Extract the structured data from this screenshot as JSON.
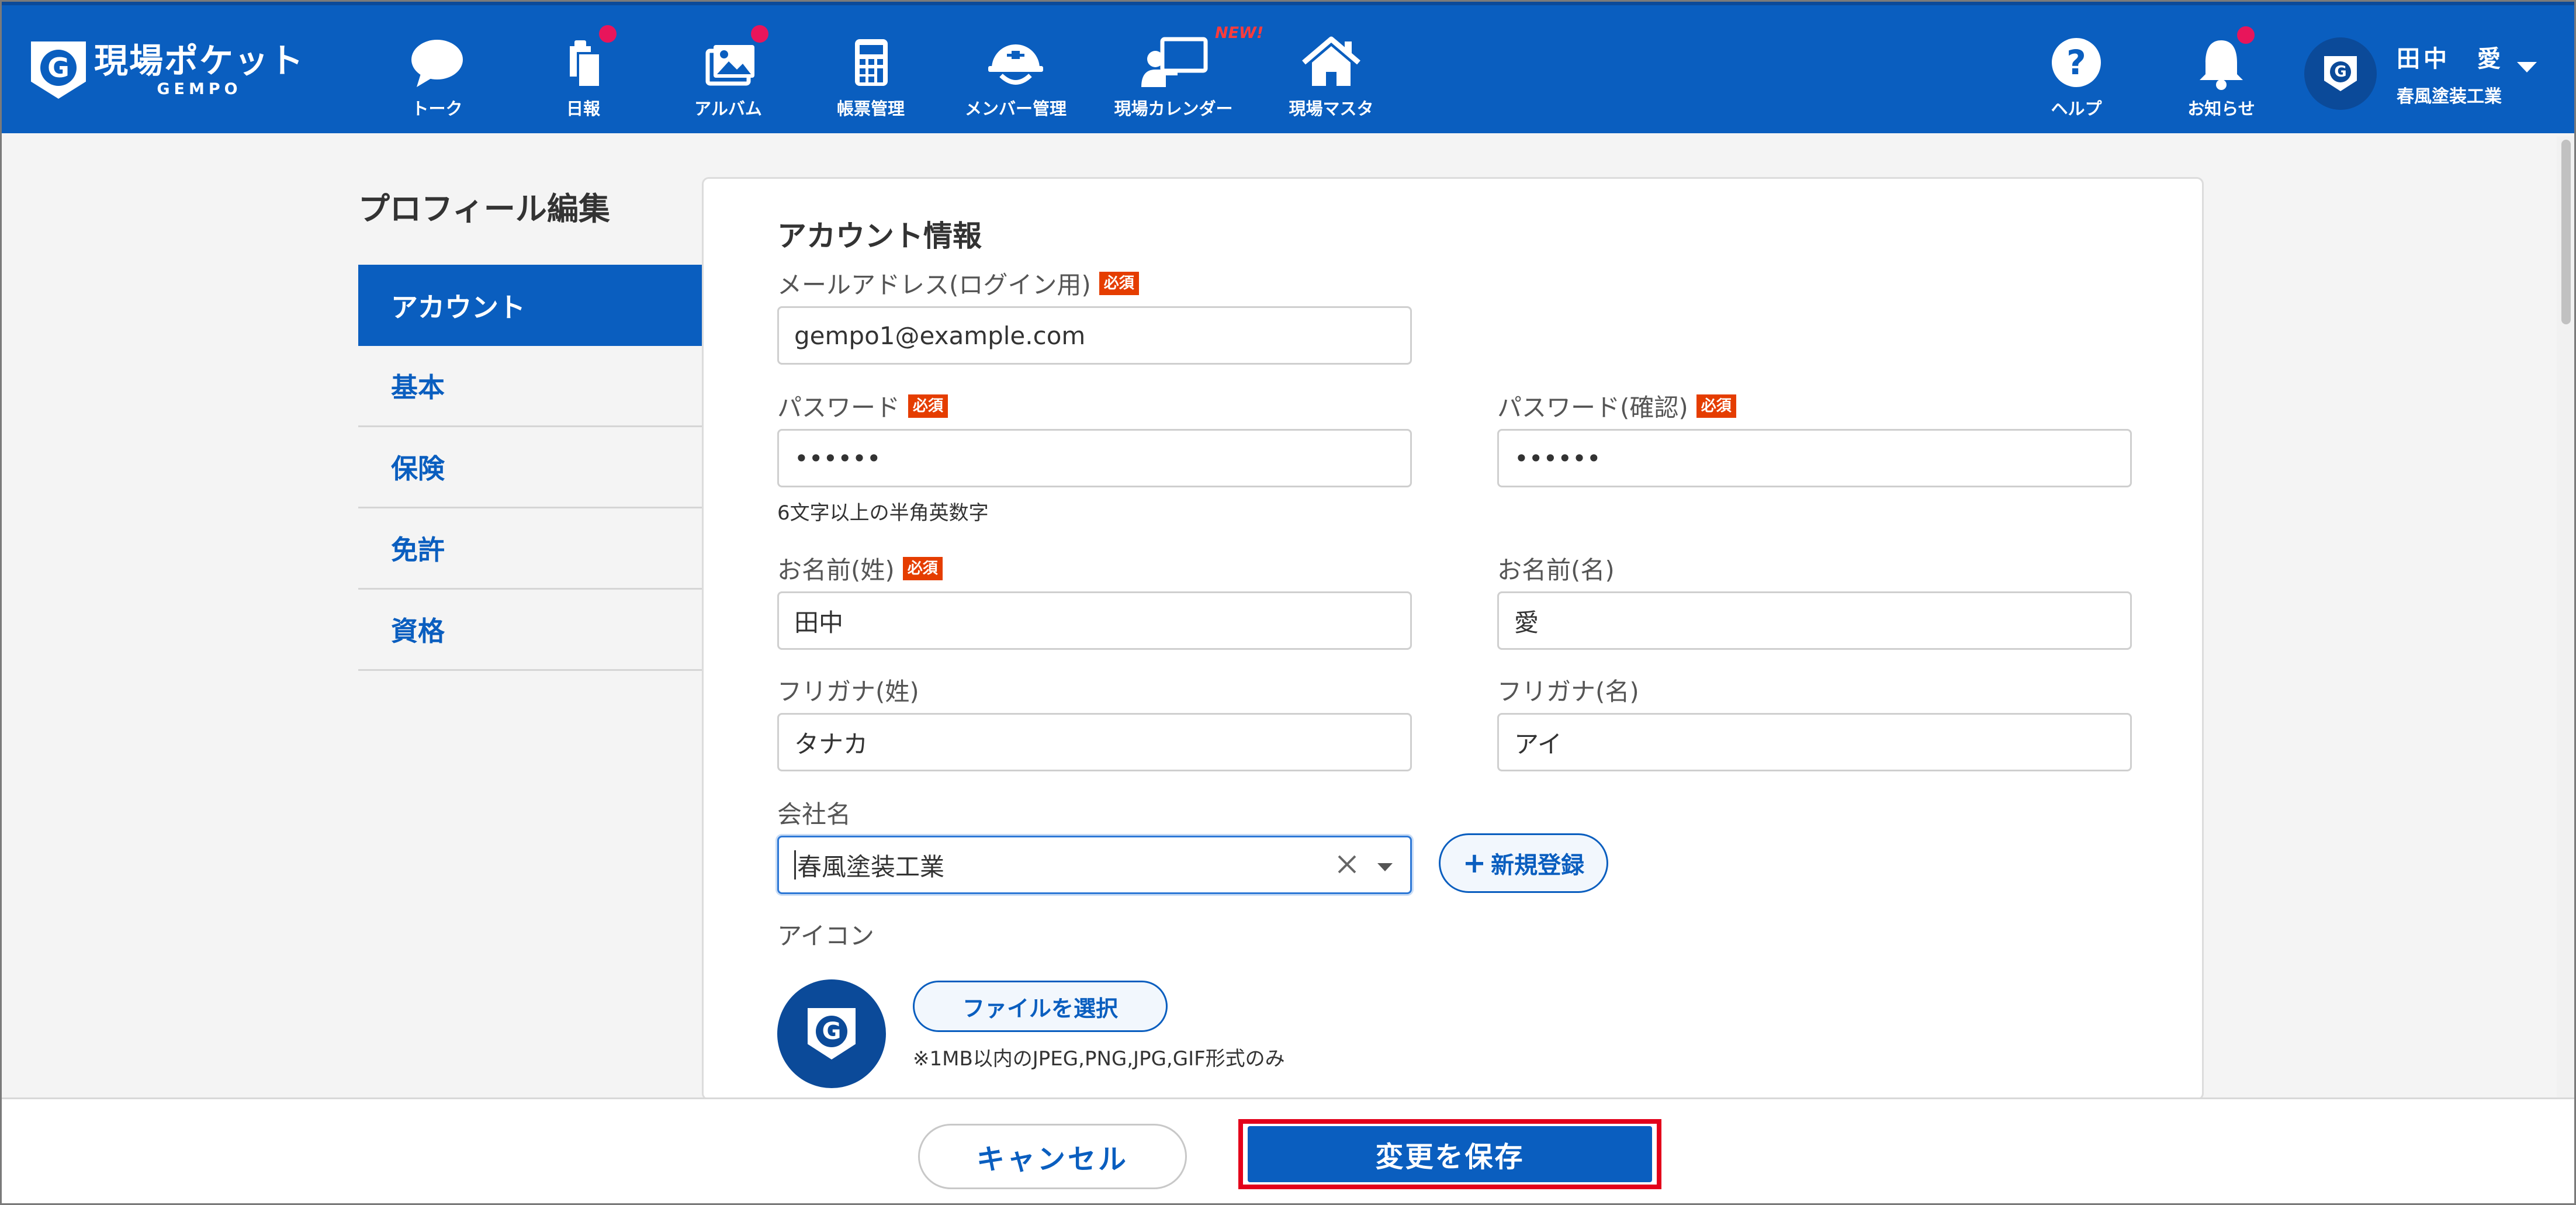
{
  "header": {
    "logo_main": "現場ポケット",
    "logo_sub": "GEMPO",
    "logo_letter": "G",
    "nav": [
      {
        "label": "トーク",
        "icon": "chat-bubble-icon",
        "badge": false
      },
      {
        "label": "日報",
        "icon": "daily-report-icon",
        "badge": true
      },
      {
        "label": "アルバム",
        "icon": "album-icon",
        "badge": true
      },
      {
        "label": "帳票管理",
        "icon": "calculator-icon",
        "badge": false
      },
      {
        "label": "メンバー管理",
        "icon": "hardhat-icon",
        "badge": false
      },
      {
        "label": "現場カレンダー",
        "icon": "calendar-presenter-icon",
        "badge": false,
        "new_label": "NEW!"
      },
      {
        "label": "現場マスタ",
        "icon": "house-icon",
        "badge": false
      }
    ],
    "help_label": "ヘルプ",
    "notice_label": "お知らせ",
    "notice_badge": true,
    "user_name": "田中　愛",
    "user_company": "春風塗装工業"
  },
  "page": {
    "title": "プロフィール編集"
  },
  "sidenav": {
    "items": [
      {
        "label": "アカウント",
        "active": true
      },
      {
        "label": "基本",
        "active": false
      },
      {
        "label": "保険",
        "active": false
      },
      {
        "label": "免許",
        "active": false
      },
      {
        "label": "資格",
        "active": false
      }
    ]
  },
  "form": {
    "section_title": "アカウント情報",
    "required_label": "必須",
    "email": {
      "label": "メールアドレス(ログイン用)",
      "value": "gempo1@example.com",
      "required": true
    },
    "password": {
      "label": "パスワード",
      "value": "••••••",
      "required": true,
      "hint": "6文字以上の半角英数字"
    },
    "password_confirm": {
      "label": "パスワード(確認)",
      "value": "••••••",
      "required": true
    },
    "last_name": {
      "label": "お名前(姓)",
      "value": "田中",
      "required": true
    },
    "first_name": {
      "label": "お名前(名)",
      "value": "愛",
      "required": false
    },
    "last_kana": {
      "label": "フリガナ(姓)",
      "value": "タナカ"
    },
    "first_kana": {
      "label": "フリガナ(名)",
      "value": "アイ"
    },
    "company": {
      "label": "会社名",
      "value": "春風塗装工業",
      "new_button": "新規登録"
    },
    "icon": {
      "label": "アイコン",
      "file_button": "ファイルを選択",
      "note": "※1MB以内のJPEG,PNG,JPG,GIF形式のみ"
    }
  },
  "footer": {
    "cancel_label": "キャンセル",
    "save_label": "変更を保存"
  },
  "colors": {
    "brand": "#0a5ebf",
    "required_badge": "#e53d00",
    "notification_dot": "#e8155b",
    "highlight": "#e3001b"
  }
}
